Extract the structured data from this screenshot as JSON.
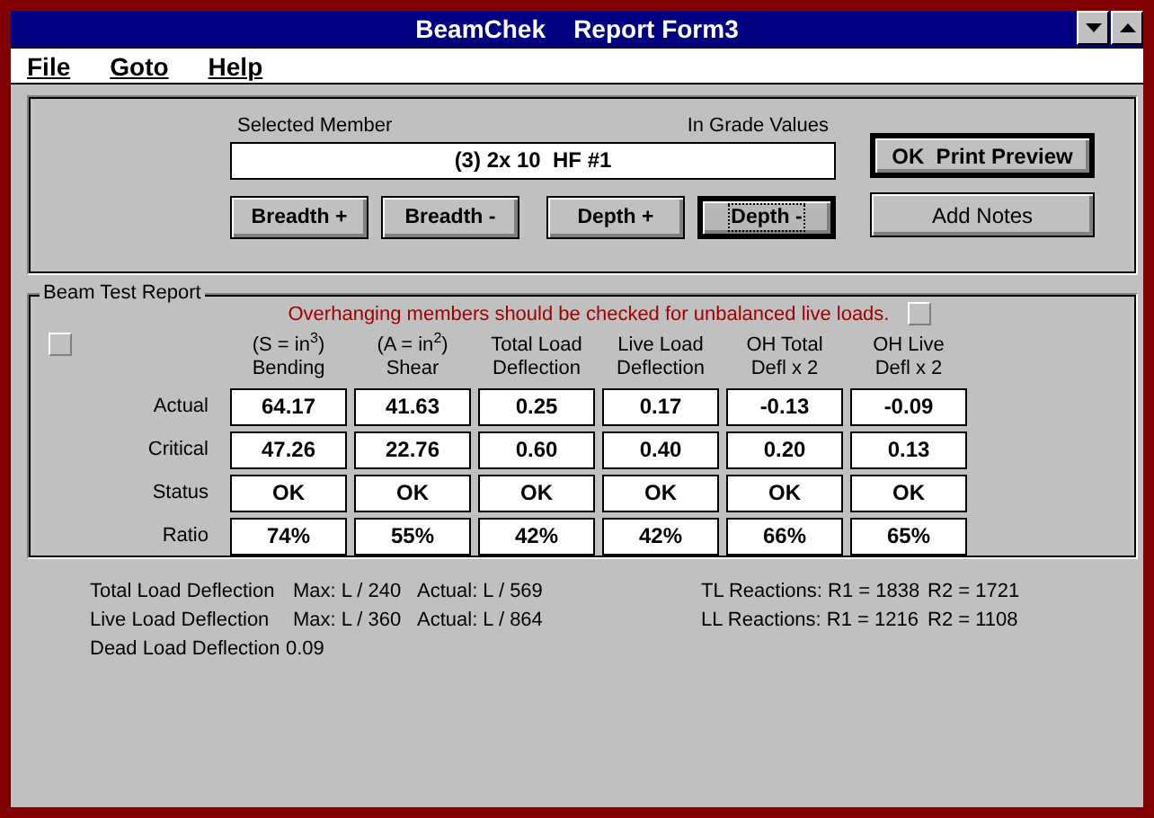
{
  "window": {
    "title": "BeamChek    Report Form3"
  },
  "menu": [
    "File",
    "Goto",
    "Help"
  ],
  "member": {
    "label": "Selected Member",
    "note": "In Grade Values",
    "value": "(3) 2x 10  HF #1"
  },
  "size_buttons": [
    {
      "label": "Breadth +",
      "focused": false
    },
    {
      "label": "Breadth -",
      "focused": false
    },
    {
      "label": "Depth +",
      "focused": false
    },
    {
      "label": "Depth -",
      "focused": true
    }
  ],
  "side_buttons": [
    {
      "label": "OK  Print Preview",
      "bold": true,
      "default": true
    },
    {
      "label": "Add Notes",
      "bold": false,
      "default": false
    }
  ],
  "report": {
    "title": "Beam Test Report",
    "warning": "Overhanging members should be checked for unbalanced live loads.",
    "columns": [
      {
        "top": "(S = in$^{3}$)",
        "bottom": "Bending"
      },
      {
        "top": "(A = in$^{2}$)",
        "bottom": "Shear"
      },
      {
        "top": "Total Load",
        "bottom": "Deflection"
      },
      {
        "top": "Live Load",
        "bottom": "Deflection"
      },
      {
        "top": "OH Total",
        "bottom": "Defl x 2"
      },
      {
        "top": "OH Live",
        "bottom": "Defl x 2"
      }
    ],
    "rows": [
      {
        "label": "Actual",
        "cells": [
          "64.17",
          "41.63",
          "0.25",
          "0.17",
          "-0.13",
          "-0.09"
        ]
      },
      {
        "label": "Critical",
        "cells": [
          "47.26",
          "22.76",
          "0.60",
          "0.40",
          "0.20",
          "0.13"
        ]
      },
      {
        "label": "Status",
        "cells": [
          "OK",
          "OK",
          "OK",
          "OK",
          "OK",
          "OK"
        ]
      },
      {
        "label": "Ratio",
        "cells": [
          "74%",
          "55%",
          "42%",
          "42%",
          "66%",
          "65%"
        ]
      }
    ]
  },
  "summary": [
    {
      "name": "Total Load Deflection",
      "max": "Max: L / 240",
      "actual": "Actual: L / 569",
      "reactions": "TL Reactions: R1 = 1838",
      "r2": "R2 = 1721"
    },
    {
      "name": "Live Load Deflection",
      "max": "Max: L / 360",
      "actual": "Actual: L / 864",
      "reactions": "LL Reactions: R1 = 1216",
      "r2": "R2 = 1108"
    }
  ],
  "dead_load": {
    "name": "Dead Load Deflection",
    "value": "0.09"
  }
}
